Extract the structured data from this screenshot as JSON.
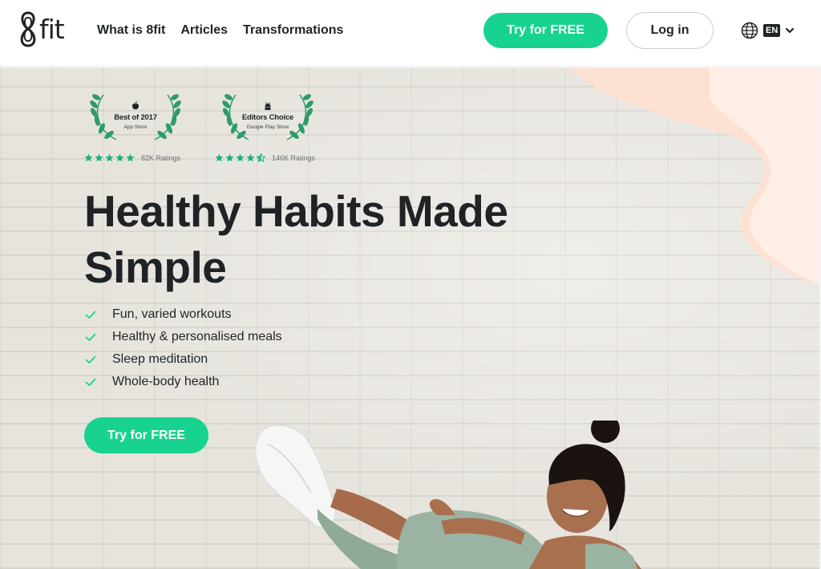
{
  "header": {
    "logo_text": "fit",
    "nav": [
      "What is 8fit",
      "Articles",
      "Transformations"
    ],
    "try_label": "Try for FREE",
    "login_label": "Log in",
    "lang_code": "EN"
  },
  "hero": {
    "badges": [
      {
        "title": "Best of 2017",
        "subtitle": "App Store",
        "icon": "apple-icon",
        "rating_label": "82K Ratings",
        "stars": 5
      },
      {
        "title": "Editors Choice",
        "subtitle": "Google Play Store",
        "icon": "android-icon",
        "rating_label": "146K Ratings",
        "stars": 4.5
      }
    ],
    "headline": "Healthy Habits Made Simple",
    "features": [
      "Fun, varied workouts",
      "Healthy & personalised meals",
      "Sleep meditation",
      "Whole-body health"
    ],
    "cta_label": "Try for FREE"
  },
  "colors": {
    "accent": "#17d38f",
    "text": "#1f2326",
    "blob": "#fde1d3",
    "blob_light": "#fff0e8"
  }
}
